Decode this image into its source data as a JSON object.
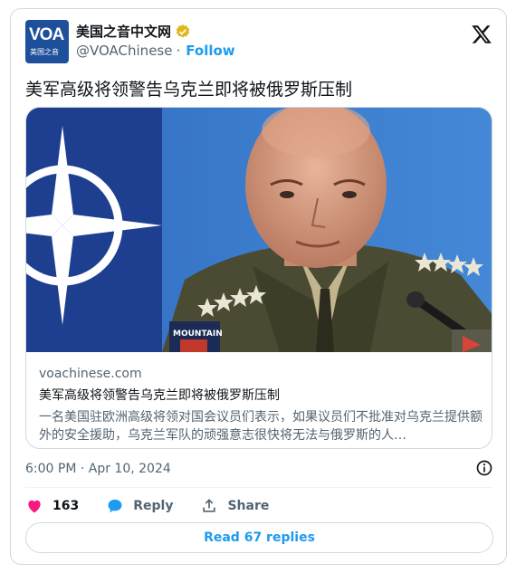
{
  "author": {
    "display_name": "美国之音中文网",
    "handle": "@VOAChinese",
    "separator": "·",
    "follow_label": "Follow",
    "avatar_text": "VOA",
    "avatar_subtext": "美国之音",
    "verified_color": "#e2b719"
  },
  "tweet": {
    "text": "美军高级将领警告乌克兰即将被俄罗斯压制",
    "timestamp": "6:00 PM · Apr 10, 2024"
  },
  "link_card": {
    "domain": "voachinese.com",
    "title": "美军高级将领警告乌克兰即将被俄罗斯压制",
    "description": "一名美国驻欧洲高级将领对国会议员们表示，如果议员们不批准对乌克兰提供额外的安全援助，乌克兰军队的顽强意志很快将无法与俄罗斯的人…",
    "image_patch_text": "MOUNTAIN"
  },
  "actions": {
    "like_count": "163",
    "reply_label": "Reply",
    "share_label": "Share"
  },
  "read_replies_label": "Read 67 replies",
  "colors": {
    "accent": "#1d9bf0",
    "like": "#f91880",
    "text_secondary": "#536471",
    "border": "#cfd9de"
  }
}
